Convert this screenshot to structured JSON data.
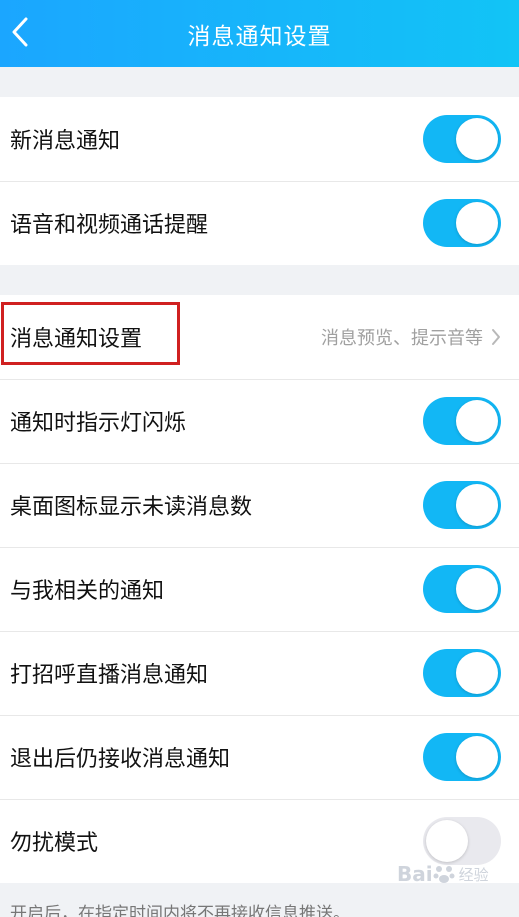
{
  "header": {
    "title": "消息通知设置"
  },
  "group1": [
    {
      "label": "新消息通知",
      "on": true
    },
    {
      "label": "语音和视频通话提醒",
      "on": true
    }
  ],
  "group2": {
    "settings_row": {
      "label": "消息通知设置",
      "detail": "消息预览、提示音等"
    },
    "toggles": [
      {
        "label": "通知时指示灯闪烁",
        "on": true
      },
      {
        "label": "桌面图标显示未读消息数",
        "on": true
      },
      {
        "label": "与我相关的通知",
        "on": true
      },
      {
        "label": "打招呼直播消息通知",
        "on": true
      },
      {
        "label": "退出后仍接收消息通知",
        "on": true
      },
      {
        "label": "勿扰模式",
        "on": false
      }
    ]
  },
  "footer": {
    "note": "开启后，在指定时间内将不再接收信息推送。"
  },
  "watermark": {
    "text": "Bai",
    "sub": "经验"
  },
  "colors": {
    "accent": "#12b7f5",
    "header_gradient_start": "#1ba6ff",
    "header_gradient_end": "#12c4f6",
    "highlight_border": "#d02020"
  }
}
